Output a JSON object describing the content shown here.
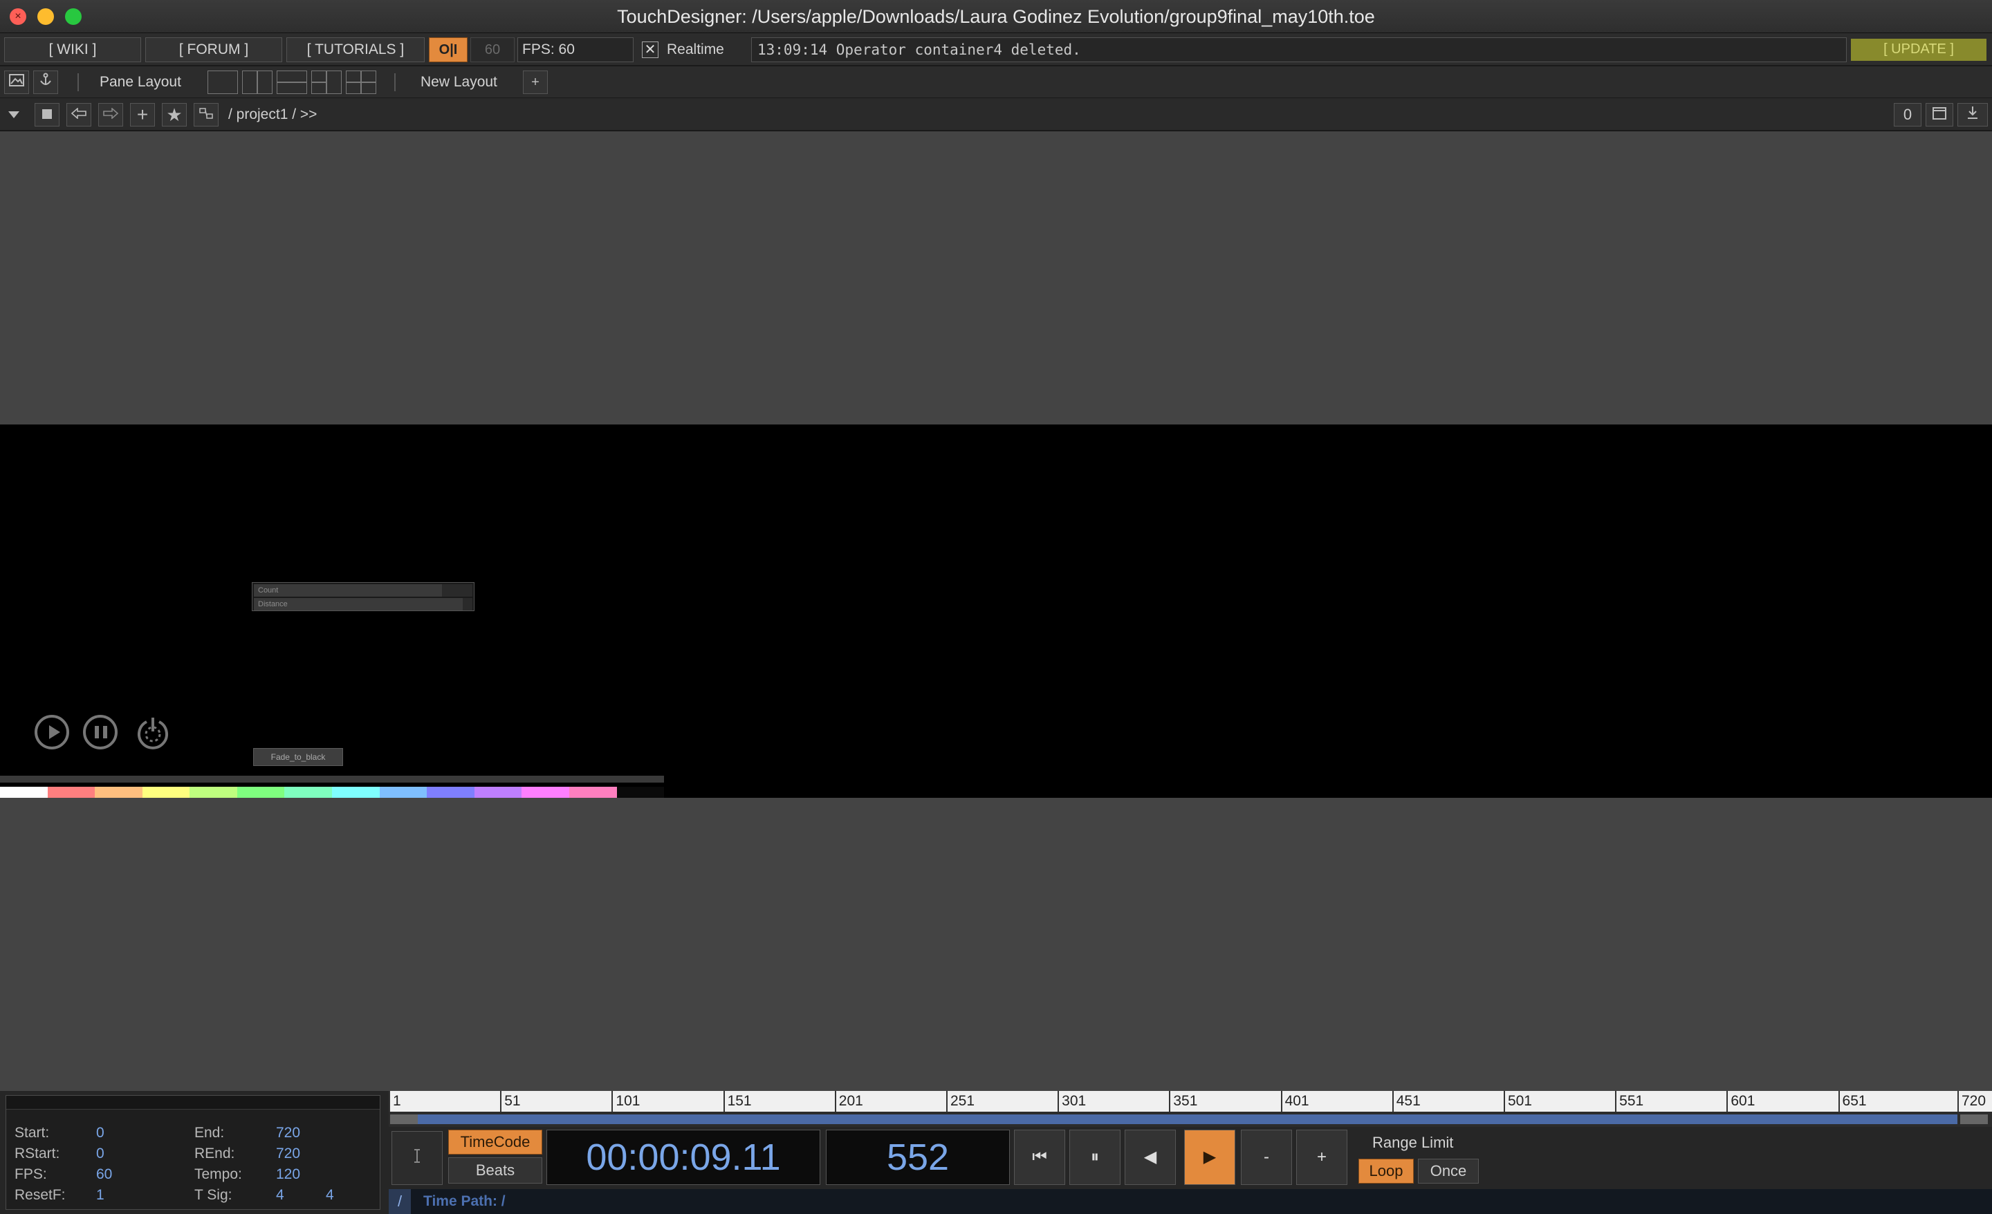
{
  "window": {
    "title": "TouchDesigner: /Users/apple/Downloads/Laura Godinez Evolution/group9final_may10th.toe"
  },
  "toolbar": {
    "wiki": "[ WIKI ]",
    "forum": "[ FORUM ]",
    "tutorials": "[ TUTORIALS ]",
    "oi": "O|I",
    "fps_cap": "60",
    "fps_label": "FPS:  60",
    "realtime_check": "✕",
    "realtime_label": "Realtime",
    "status_message": "13:09:14 Operator container4 deleted.",
    "update": "[ UPDATE ]"
  },
  "panebar": {
    "pane_layout": "Pane Layout",
    "new_layout": "New Layout",
    "add": "+"
  },
  "navbar": {
    "path": "/ project1 / >>",
    "counter": "0"
  },
  "viewer": {
    "slider_count": "Count",
    "slider_distance": "Distance",
    "fade_button": "Fade_to_black",
    "palette": [
      "#ffffff",
      "#ff7f7f",
      "#ffbf7f",
      "#ffff7f",
      "#bfff7f",
      "#7fff7f",
      "#7fffbf",
      "#7fffff",
      "#7fbfff",
      "#7f7fff",
      "#bf7fff",
      "#ff7fff",
      "#ff7fbf",
      "#0a0a0a"
    ]
  },
  "timeline": {
    "info": {
      "start_label": "Start:",
      "start": "0",
      "end_label": "End:",
      "end": "720",
      "rstart_label": "RStart:",
      "rstart": "0",
      "rend_label": "REnd:",
      "rend": "720",
      "fps_label": "FPS:",
      "fps": "60",
      "tempo_label": "Tempo:",
      "tempo": "120",
      "resetf_label": "ResetF:",
      "resetf": "1",
      "tsig_label": "T Sig:",
      "tsig_a": "4",
      "tsig_b": "4"
    },
    "ruler_ticks": [
      "1",
      "51",
      "101",
      "151",
      "201",
      "251",
      "301",
      "351",
      "401",
      "451",
      "501",
      "551",
      "601",
      "651",
      "720"
    ],
    "timecode_btn": "TimeCode",
    "beats_btn": "Beats",
    "timecode": "00:00:09.11",
    "frame": "552",
    "controls": {
      "rewind": "⏮",
      "pause": "⏸",
      "step_back": "◀",
      "play": "▶",
      "minus": "-",
      "plus": "+"
    },
    "range_limit": "Range Limit",
    "loop": "Loop",
    "once": "Once",
    "time_path_slash": "/",
    "time_path": "Time Path: /"
  },
  "colors": {
    "accent_orange": "#e38a3d",
    "update_olive": "#888a2c",
    "value_blue": "#7aa6e8",
    "network_bg": "#444444"
  }
}
